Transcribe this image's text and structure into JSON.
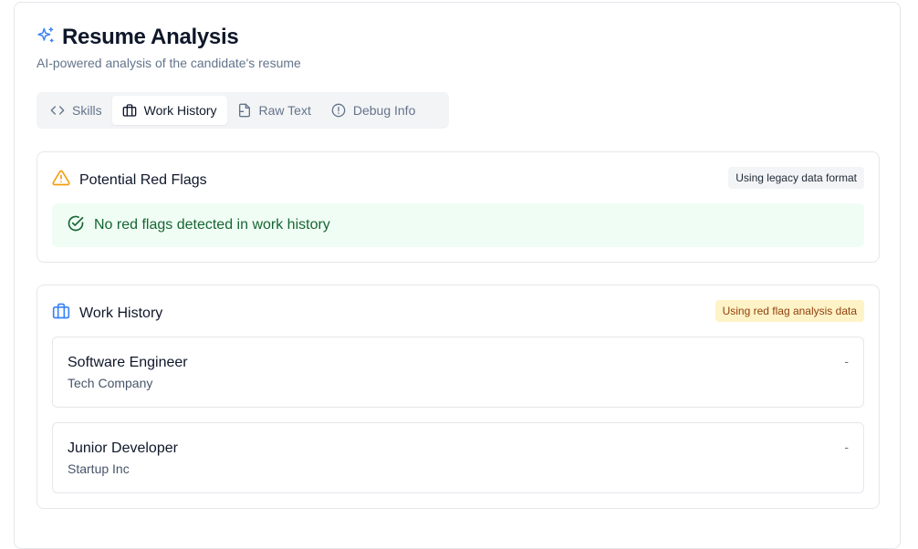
{
  "header": {
    "title": "Resume Analysis",
    "subtitle": "AI-powered analysis of the candidate's resume"
  },
  "tabs": [
    {
      "label": "Skills",
      "icon": "code-icon",
      "active": false
    },
    {
      "label": "Work History",
      "icon": "briefcase-icon",
      "active": true
    },
    {
      "label": "Raw Text",
      "icon": "file-icon",
      "active": false
    },
    {
      "label": "Debug Info",
      "icon": "alert-circle-icon",
      "active": false
    }
  ],
  "red_flags": {
    "title": "Potential Red Flags",
    "badge": "Using legacy data format",
    "status": "No red flags detected in work history"
  },
  "work_history": {
    "title": "Work History",
    "badge": "Using red flag analysis data",
    "jobs": [
      {
        "title": "Software Engineer",
        "company": "Tech Company",
        "dates": "-"
      },
      {
        "title": "Junior Developer",
        "company": "Startup Inc",
        "dates": "-"
      }
    ]
  },
  "colors": {
    "accent": "#3b82f6",
    "warning": "#f59e0b",
    "success": "#166534",
    "success_bg": "#f0fdf4",
    "badge_yellow_bg": "#fef3c7"
  }
}
